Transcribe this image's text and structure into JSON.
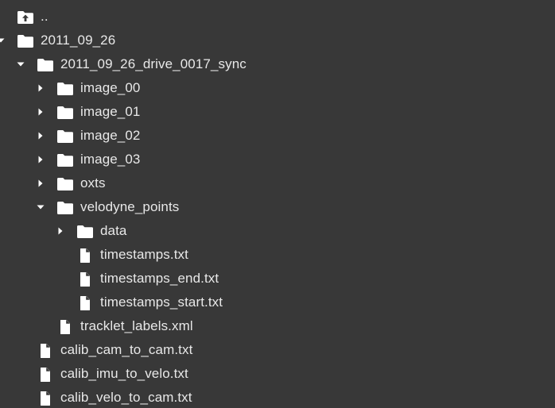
{
  "colors": {
    "background": "#383838",
    "text": "#e8e8e8",
    "icon": "#ffffff"
  },
  "tree": [
    {
      "label": "..",
      "icon": "upload-folder-icon",
      "caret": "none",
      "depth": 0
    },
    {
      "label": "2011_09_26",
      "icon": "folder-icon",
      "caret": "down",
      "depth": 0
    },
    {
      "label": "2011_09_26_drive_0017_sync",
      "icon": "folder-icon",
      "caret": "down",
      "depth": 1
    },
    {
      "label": "image_00",
      "icon": "folder-icon",
      "caret": "right",
      "depth": 2
    },
    {
      "label": "image_01",
      "icon": "folder-icon",
      "caret": "right",
      "depth": 2
    },
    {
      "label": "image_02",
      "icon": "folder-icon",
      "caret": "right",
      "depth": 2
    },
    {
      "label": "image_03",
      "icon": "folder-icon",
      "caret": "right",
      "depth": 2
    },
    {
      "label": "oxts",
      "icon": "folder-icon",
      "caret": "right",
      "depth": 2
    },
    {
      "label": "velodyne_points",
      "icon": "folder-icon",
      "caret": "down",
      "depth": 2
    },
    {
      "label": "data",
      "icon": "folder-icon",
      "caret": "right",
      "depth": 3
    },
    {
      "label": "timestamps.txt",
      "icon": "file-icon",
      "caret": "none",
      "depth": 3
    },
    {
      "label": "timestamps_end.txt",
      "icon": "file-icon",
      "caret": "none",
      "depth": 3
    },
    {
      "label": "timestamps_start.txt",
      "icon": "file-icon",
      "caret": "none",
      "depth": 3
    },
    {
      "label": "tracklet_labels.xml",
      "icon": "file-icon",
      "caret": "none",
      "depth": 2
    },
    {
      "label": "calib_cam_to_cam.txt",
      "icon": "file-icon",
      "caret": "none",
      "depth": 1
    },
    {
      "label": "calib_imu_to_velo.txt",
      "icon": "file-icon",
      "caret": "none",
      "depth": 1
    },
    {
      "label": "calib_velo_to_cam.txt",
      "icon": "file-icon",
      "caret": "none",
      "depth": 1
    }
  ]
}
